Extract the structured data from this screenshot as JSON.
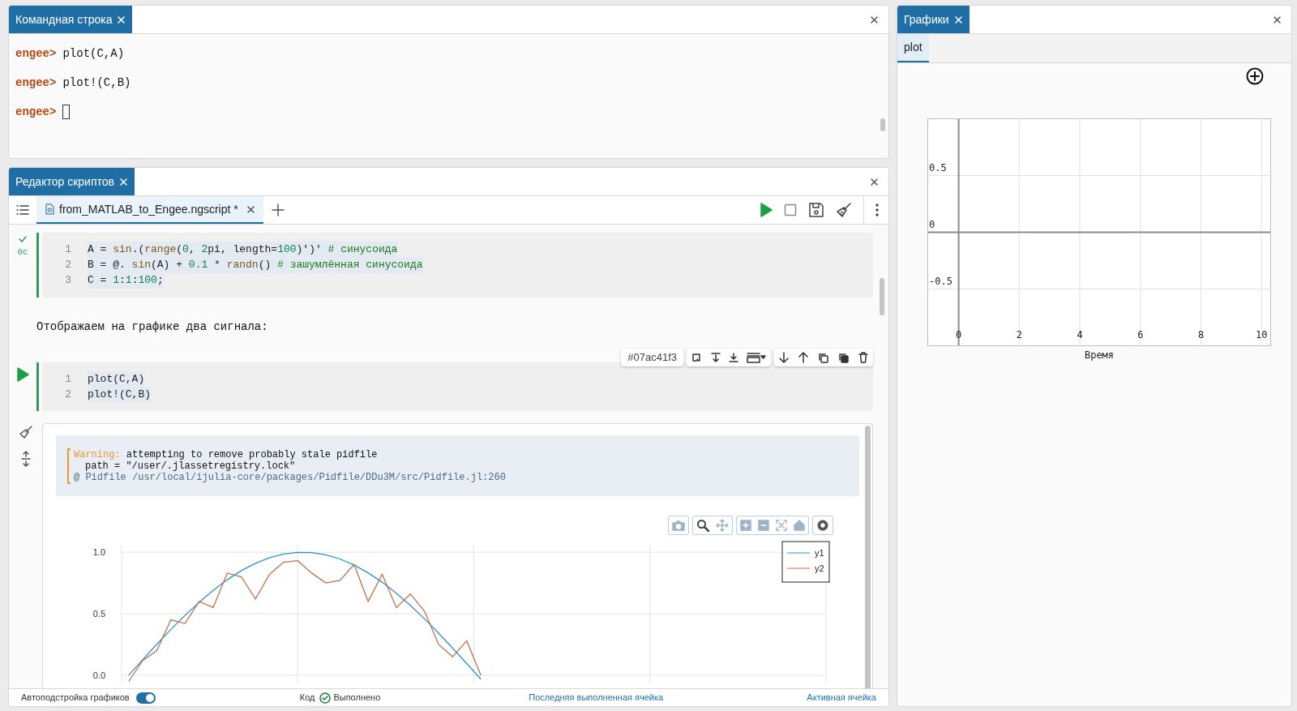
{
  "command_window": {
    "tab": {
      "label": "Командная строка"
    },
    "lines": [
      {
        "prompt": "engee>",
        "input": "plot(C,A)"
      },
      {
        "prompt": "engee>",
        "input": "plot!(C,B)"
      },
      {
        "prompt": "engee>",
        "cursor": true
      }
    ]
  },
  "script_editor": {
    "tab": {
      "label": "Редактор скриптов"
    },
    "files": [
      {
        "name": "from_MATLAB_to_Engee.ngscript *",
        "selected": true
      }
    ],
    "cells": [
      {
        "kind": "code",
        "executed": true,
        "time": "0c",
        "lines": [
          {
            "number": "1",
            "tokens": [
              {
                "t": "A = ",
                "kind": "plain"
              },
              {
                "t": "sin",
                "kind": "fn"
              },
              {
                "t": ".(",
                "kind": "plain"
              },
              {
                "t": "range",
                "kind": "fn"
              },
              {
                "t": "(",
                "kind": "plain"
              },
              {
                "t": "0",
                "kind": "num"
              },
              {
                "t": ", ",
                "kind": "plain"
              },
              {
                "t": "2",
                "kind": "num"
              },
              {
                "t": "pi, length=",
                "kind": "plain"
              },
              {
                "t": "100",
                "kind": "num"
              },
              {
                "t": ")')' ",
                "kind": "plain"
              },
              {
                "t": "# синусоида",
                "kind": "comment"
              }
            ]
          },
          {
            "number": "2",
            "tokens": [
              {
                "t": "B = @. ",
                "kind": "plain"
              },
              {
                "t": "sin",
                "kind": "fn"
              },
              {
                "t": "(A) + ",
                "kind": "plain"
              },
              {
                "t": "0.1",
                "kind": "num"
              },
              {
                "t": " * ",
                "kind": "plain"
              },
              {
                "t": "randn",
                "kind": "fn"
              },
              {
                "t": "() ",
                "kind": "plain"
              },
              {
                "t": "# зашумлённая синусоида",
                "kind": "comment"
              }
            ]
          },
          {
            "number": "3",
            "tokens": [
              {
                "t": "C = ",
                "kind": "plain"
              },
              {
                "t": "1",
                "kind": "num"
              },
              {
                "t": ":",
                "kind": "plain"
              },
              {
                "t": "1",
                "kind": "num"
              },
              {
                "t": ":",
                "kind": "plain"
              },
              {
                "t": "100",
                "kind": "num"
              },
              {
                "t": ";",
                "kind": "plain"
              }
            ]
          }
        ]
      },
      {
        "kind": "markdown",
        "text": "Отображаем на графике два сигнала:"
      },
      {
        "kind": "code",
        "executed": false,
        "cell_id": "#07ac41f3",
        "lines": [
          {
            "number": "1",
            "tokens": [
              {
                "t": "plot(C,A)",
                "kind": "plain"
              }
            ]
          },
          {
            "number": "2",
            "tokens": [
              {
                "t": "plot!(C,B)",
                "kind": "plain"
              }
            ]
          }
        ],
        "output": {
          "warning": {
            "label": "Warning:",
            "message": "attempting to remove probably stale pidfile",
            "detail": "path = \"/user/.jlassetregistry.lock\"",
            "source": "@ Pidfile /usr/local/ijulia-core/packages/Pidfile/DDu3M/src/Pidfile.jl:260"
          },
          "chart_data": {
            "type": "line",
            "categories": [
              null,
              null,
              null,
              null,
              null,
              null,
              null,
              null,
              null,
              null,
              null,
              null,
              null,
              null,
              null,
              null,
              null,
              null,
              null,
              null,
              null,
              null,
              null,
              null,
              null,
              null,
              null,
              null,
              null,
              null,
              null,
              null,
              null,
              null,
              null,
              null,
              null,
              null,
              null,
              null,
              null,
              null,
              null,
              null,
              null,
              null,
              null,
              null,
              null,
              null
            ],
            "series": [
              {
                "name": "y1",
                "color": "#2f8fd0",
                "values": [
                  0,
                  0.127,
                  0.251,
                  0.372,
                  0.486,
                  0.593,
                  0.69,
                  0.776,
                  0.85,
                  0.91,
                  0.955,
                  0.985,
                  0.999,
                  0.997,
                  0.979,
                  0.945,
                  0.896,
                  0.832,
                  0.756,
                  0.667,
                  0.567,
                  0.458,
                  0.342,
                  0.22,
                  0.095,
                  -0.032,
                  null,
                  null,
                  null,
                  null,
                  null,
                  null,
                  null,
                  null,
                  null,
                  null,
                  null,
                  null,
                  null,
                  null,
                  null,
                  null,
                  null,
                  null,
                  null,
                  null,
                  null,
                  null,
                  null,
                  null
                ]
              },
              {
                "name": "y2",
                "color": "#c0704a",
                "values": [
                  -0.05,
                  0.12,
                  0.2,
                  0.45,
                  0.42,
                  0.6,
                  0.55,
                  0.83,
                  0.8,
                  0.62,
                  0.82,
                  0.92,
                  0.93,
                  0.83,
                  0.75,
                  0.77,
                  0.9,
                  0.6,
                  0.82,
                  0.55,
                  0.66,
                  0.52,
                  0.25,
                  0.15,
                  0.28,
                  0,
                  null,
                  null,
                  null,
                  null,
                  null,
                  null,
                  null,
                  null,
                  null,
                  null,
                  null,
                  null,
                  null,
                  null,
                  null,
                  null,
                  null,
                  null,
                  null,
                  null,
                  null,
                  null,
                  null,
                  null
                ]
              }
            ],
            "ylim": [
              -0.06,
              1.06
            ],
            "grid": true,
            "legend": "upper right",
            "yticks": [
              {
                "value": 0,
                "label": "0.0"
              },
              {
                "value": 0.5,
                "label": "0.5"
              },
              {
                "value": 1,
                "label": "1.0"
              }
            ]
          }
        }
      }
    ]
  },
  "status_bar": {
    "auto_fit": {
      "label": "Автоподстройка графиков",
      "on": true
    },
    "code_label": "Код",
    "code_status": "Выполнено",
    "last_cell_link": "Последняя выполненная ячейка",
    "active_cell_link": "Активная ячейка"
  },
  "graphs_panel": {
    "tab": {
      "label": "Графики"
    },
    "plots": [
      {
        "label": "plot",
        "selected": true
      }
    ],
    "chart_data": {
      "type": "line",
      "xlabel": "Время",
      "xlim": [
        -1.02,
        10.3
      ],
      "ylim": [
        -1,
        1
      ],
      "xticks": [
        0,
        2,
        4,
        6,
        8,
        10
      ],
      "yticks": [
        -0.5,
        0,
        0.5
      ],
      "grid": true
    }
  }
}
